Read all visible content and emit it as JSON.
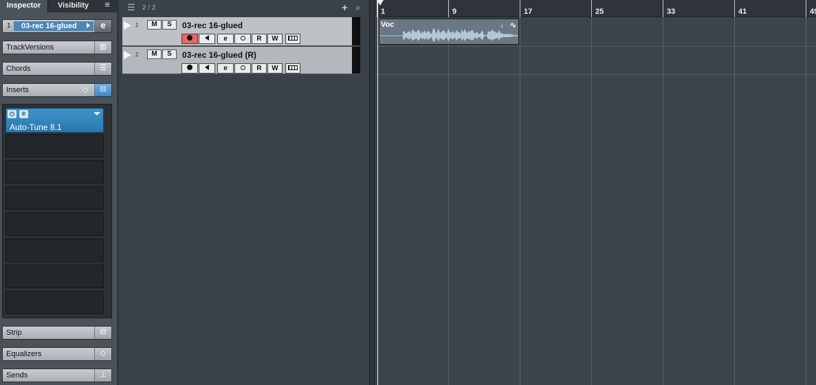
{
  "inspector": {
    "tabs": {
      "inspector": "Inspector",
      "visibility": "Visibility",
      "menu_icon": "menu-icon"
    },
    "track": {
      "number": "1",
      "name": "03-rec 16-glued",
      "edit_icon": "edit-icon"
    },
    "sections": {
      "trackversions": "TrackVersions",
      "chords": "Chords",
      "inserts": "Inserts",
      "strip": "Strip",
      "equalizers": "Equalizers",
      "sends": "Sends"
    },
    "insert_slot_1": {
      "plugin": "Auto-Tune 8.1",
      "power_icon": "power-icon",
      "edit_icon": "edit-icon"
    }
  },
  "tracklist": {
    "count": "2 / 2",
    "tracks": [
      {
        "number": "1",
        "name": "03-rec 16-glued",
        "mute": "M",
        "solo": "S",
        "read": "R",
        "write": "W",
        "record_armed": true
      },
      {
        "number": "2",
        "name": "03-rec 16-glued (R)",
        "mute": "M",
        "solo": "S",
        "read": "R",
        "write": "W",
        "record_armed": false
      }
    ]
  },
  "ruler": {
    "bars": [
      "1",
      "9",
      "17",
      "25",
      "33",
      "41",
      "49"
    ]
  },
  "event": {
    "name": "Voc"
  },
  "colors": {
    "accent": "#3d94c9",
    "record_armed": "#e26a6a",
    "event": "#6a7886"
  }
}
